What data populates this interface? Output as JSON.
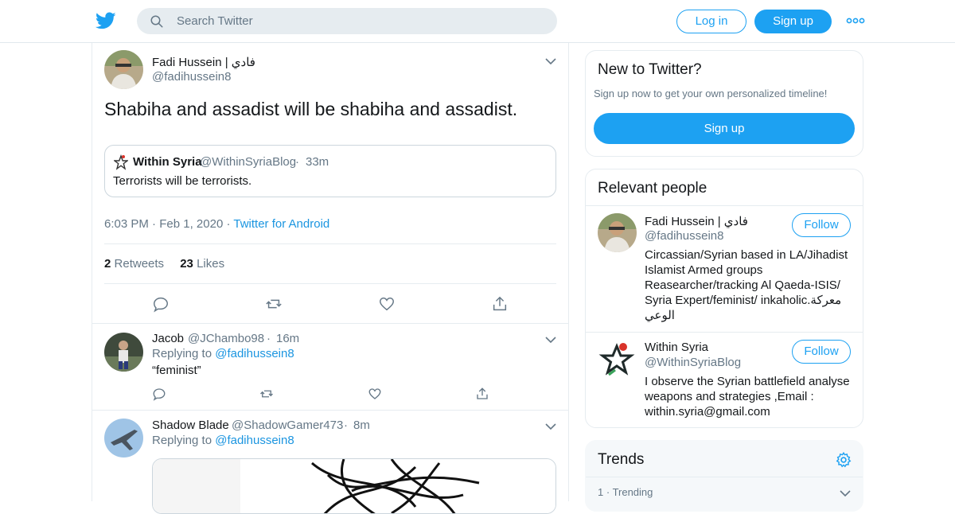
{
  "header": {
    "logo_icon": "twitter-bird-icon",
    "search_placeholder": "Search Twitter",
    "login_label": "Log in",
    "signup_label": "Sign up",
    "more_icon": "more-dots-icon",
    "brand_color": "#1da1f2"
  },
  "tweet": {
    "author_name": "Fadi Hussein | فادي",
    "author_handle": "@fadihussein8",
    "text": "Shabiha and assadist will be shabiha and assadist.",
    "quote": {
      "name": "Within Syria",
      "handle": "@WithinSyriaBlog",
      "time": "33m",
      "text": "Terrorists will be terrorists."
    },
    "time": "6:03 PM",
    "date": "Feb 1, 2020",
    "source": "Twitter for Android",
    "retweets_count": "2",
    "retweets_label": "Retweets",
    "likes_count": "23",
    "likes_label": "Likes"
  },
  "replies": [
    {
      "name": "Jacob",
      "handle": "@JChambo98",
      "time": "16m",
      "replying_to_prefix": "Replying to",
      "replying_to": "@fadihussein8",
      "text": "“feminist”"
    },
    {
      "name": "Shadow Blade",
      "handle": "@ShadowGamer473",
      "time": "8m",
      "replying_to_prefix": "Replying to",
      "replying_to": "@fadihussein8"
    }
  ],
  "sidebar": {
    "new_to_twitter": {
      "title": "New to Twitter?",
      "subtitle": "Sign up now to get your own personalized timeline!",
      "button": "Sign up"
    },
    "relevant": {
      "title": "Relevant people",
      "people": [
        {
          "name": "Fadi Hussein | فادي",
          "handle": "@fadihussein8",
          "follow": "Follow",
          "bio": "Circassian/Syrian based in LA/Jihadist Islamist Armed groups Reasearcher/tracking Al Qaeda-ISIS/ Syria Expert/feminist/ inkaholic.معركة الوعي"
        },
        {
          "name": "Within Syria",
          "handle": "@WithinSyriaBlog",
          "follow": "Follow",
          "bio": "I observe the Syrian battlefield analyse weapons and strategies ,Email : within.syria@gmail.com"
        }
      ]
    },
    "trends": {
      "title": "Trends",
      "settings_icon": "gear-icon",
      "first_rank": "1",
      "first_label": "Trending"
    }
  }
}
